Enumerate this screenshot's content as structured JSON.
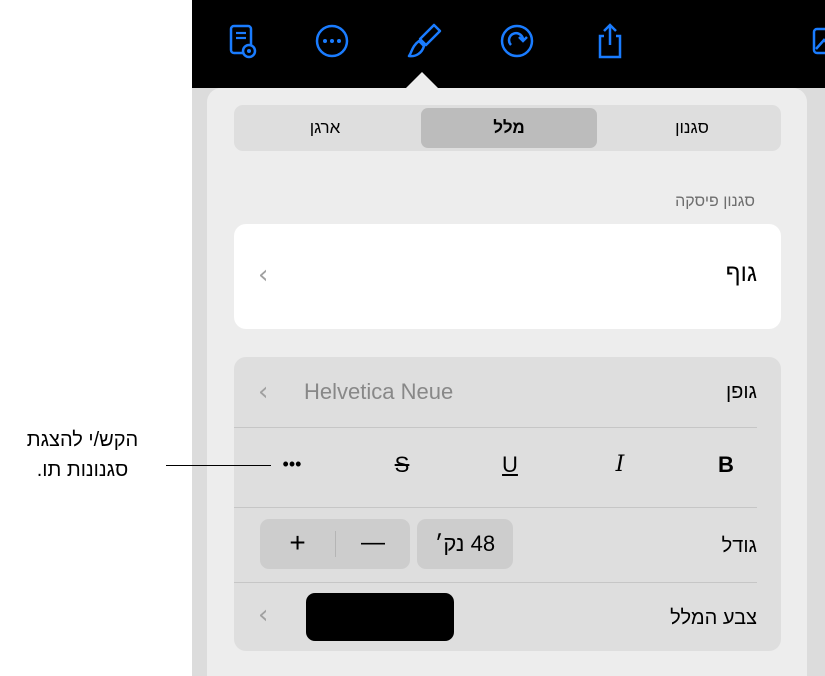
{
  "segments": {
    "style": "סגנון",
    "text": "מלל",
    "arrange": "ארגן"
  },
  "paragraph_style": {
    "label": "סגנון פיסקה",
    "value": "גוף"
  },
  "font": {
    "label": "גופן",
    "value": "Helvetica Neue"
  },
  "format": {
    "bold": "B",
    "italic": "I",
    "underline": "U",
    "strike": "S",
    "more": "•••"
  },
  "size": {
    "label": "גודל",
    "value": "48 נק׳",
    "plus": "+",
    "minus": "—"
  },
  "text_color": {
    "label": "צבע המלל",
    "color": "#000000"
  },
  "callout": {
    "line1": "הקש/י להצגת",
    "line2": "סגנונות תו."
  },
  "toolbar_icons": [
    "reader-view-icon",
    "more-icon",
    "paintbrush-icon",
    "undo-icon",
    "share-icon",
    "media-icon"
  ]
}
